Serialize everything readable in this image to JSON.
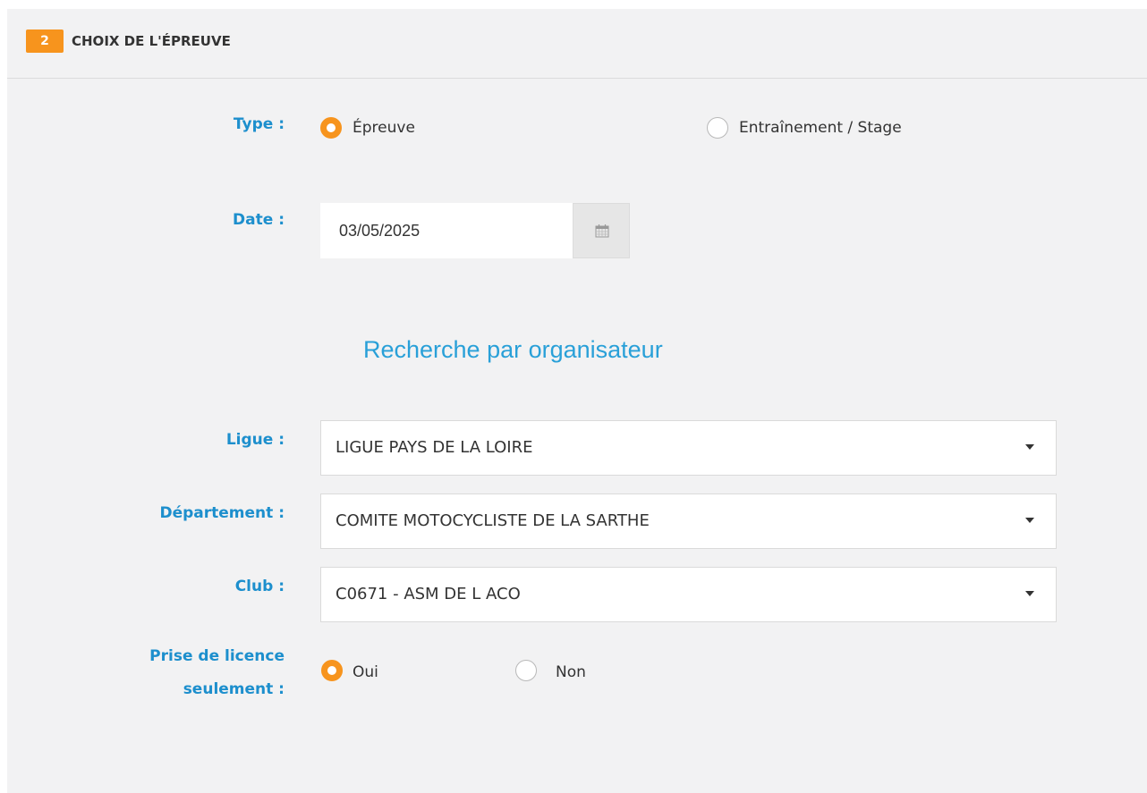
{
  "header": {
    "step": "2",
    "title": "CHOIX DE L'ÉPREUVE"
  },
  "type_field": {
    "label": "Type :",
    "options": [
      {
        "label": "Épreuve",
        "checked": true
      },
      {
        "label": "Entraînement / Stage",
        "checked": false
      }
    ]
  },
  "date_field": {
    "label": "Date :",
    "value": "03/05/2025",
    "button_icon": "calendar-icon"
  },
  "organizer_search": {
    "heading": "Recherche par organisateur"
  },
  "ligue_field": {
    "label": "Ligue :",
    "value": "LIGUE PAYS DE LA LOIRE"
  },
  "departement_field": {
    "label": "Département :",
    "value": "COMITE MOTOCYCLISTE DE LA SARTHE"
  },
  "club_field": {
    "label": "Club :",
    "value": "C0671 - ASM DE L ACO"
  },
  "licence_field": {
    "label_line1": "Prise de licence",
    "label_line2": "seulement :",
    "options": [
      {
        "label": "Oui",
        "checked": true
      },
      {
        "label": "Non",
        "checked": false
      }
    ]
  },
  "colors": {
    "accent": "#f7941d",
    "label_blue": "#1d8fcd",
    "heading_blue": "#29a0d8",
    "panel_bg": "#f2f2f3"
  }
}
